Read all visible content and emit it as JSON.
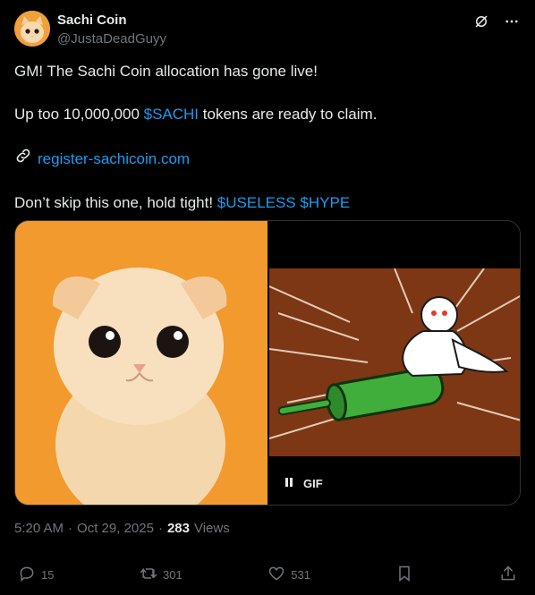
{
  "author": {
    "name": "Sachi Coin",
    "handle": "@JustaDeadGuyy"
  },
  "tweet": {
    "line1": "GM! The Sachi Coin allocation has gone live!",
    "line2_pre": "Up too 10,000,000 ",
    "line2_tag": "$SACHI",
    "line2_post": " tokens are ready to claim.",
    "link": "register-sachicoin.com",
    "line4_pre": "Don’t skip this one, hold tight! ",
    "line4_tag1": "$USELESS",
    "line4_tag2": "$HYPE"
  },
  "media": {
    "gif_label": "GIF"
  },
  "meta": {
    "time": "5:20 AM",
    "sep1": "·",
    "date": "Oct 29, 2025",
    "sep2": "·",
    "views_count": "283",
    "views_label": "Views"
  },
  "actions": {
    "replies": "15",
    "reposts": "301",
    "likes": "531"
  },
  "colors": {
    "accent": "#1d9bf0",
    "background": "#000000",
    "muted": "#71767b"
  }
}
